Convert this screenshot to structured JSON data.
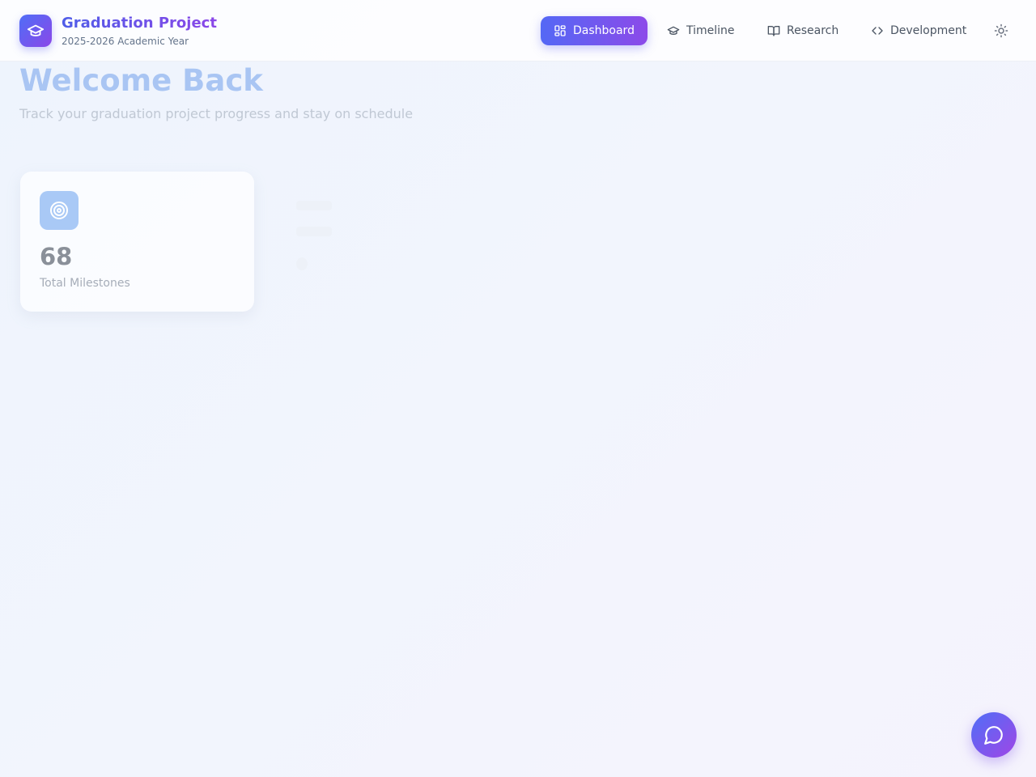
{
  "header": {
    "brand_title": "Graduation Project",
    "brand_subtitle": "2025-2026 Academic Year",
    "nav": [
      {
        "label": "Dashboard",
        "icon": "grid-icon",
        "active": true
      },
      {
        "label": "Timeline",
        "icon": "graduation-cap-icon",
        "active": false
      },
      {
        "label": "Research",
        "icon": "book-open-icon",
        "active": false
      },
      {
        "label": "Development",
        "icon": "code-icon",
        "active": false
      }
    ],
    "theme_toggle_icon": "sun-icon"
  },
  "hero": {
    "title": "Welcome Back",
    "subtitle": "Track your graduation project progress and stay on schedule"
  },
  "stats": [
    {
      "value": "68",
      "label": "Total Milestones",
      "icon": "target-icon"
    }
  ],
  "chat_button_icon": "chat-bubble-icon",
  "colors": {
    "accent_start": "#4f6ef7",
    "accent_end": "#8b47e8",
    "welcome_title": "#a9c5f3",
    "card_icon_bg": "#a9c9f6"
  }
}
